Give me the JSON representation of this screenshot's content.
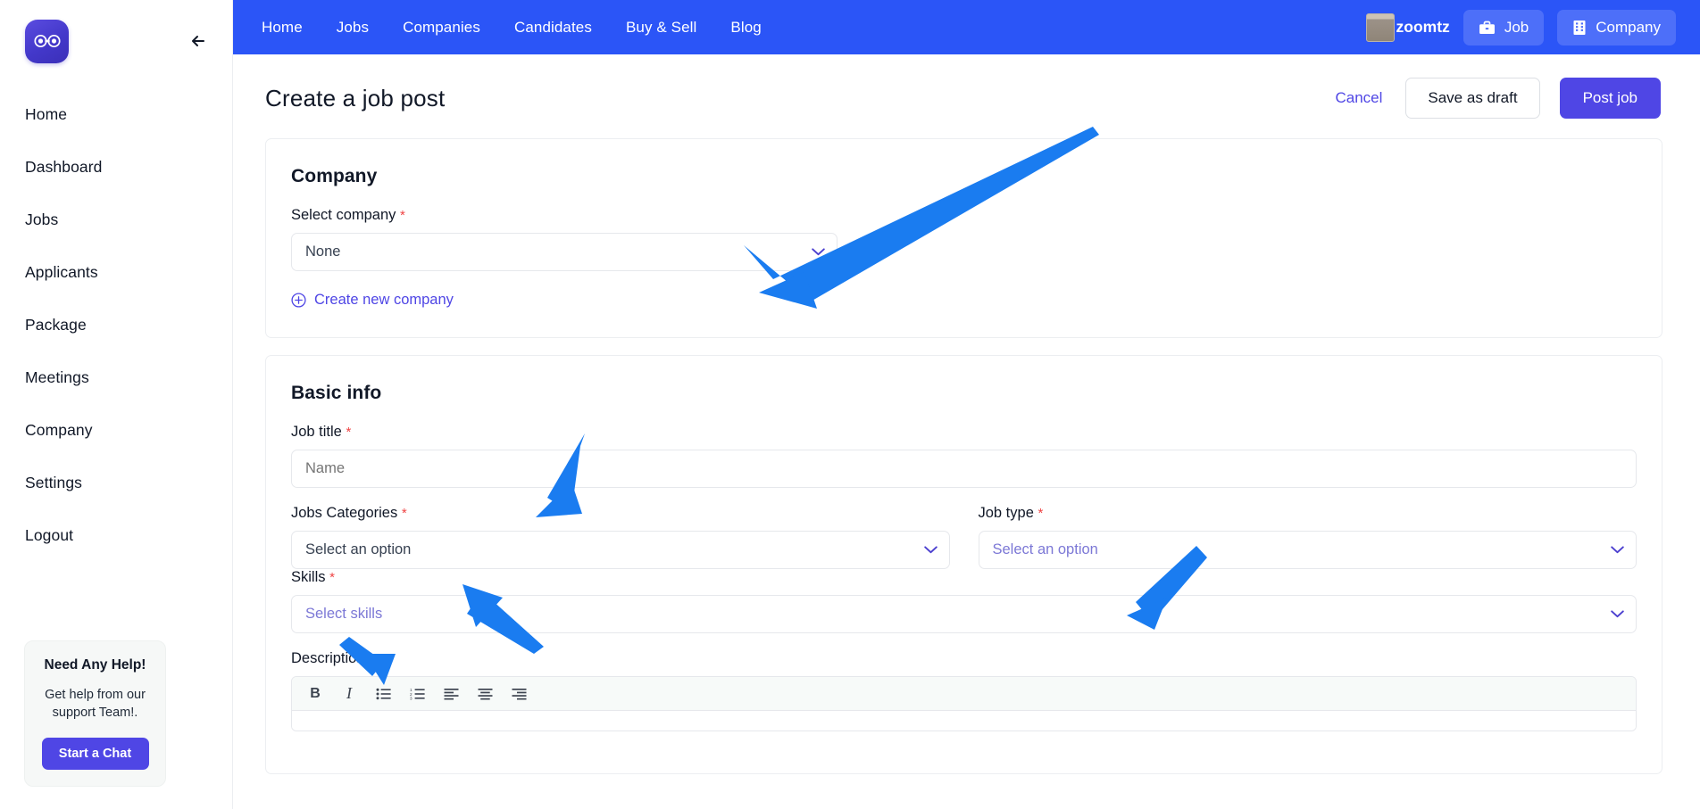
{
  "brand": {
    "logo_icon": "binoculars-icon",
    "accent": "#4f46e5",
    "topbar_bg": "#2b55f7",
    "required_mark": "*"
  },
  "sidebar": {
    "collapse_icon": "arrow-left-icon",
    "items": [
      {
        "label": "Home"
      },
      {
        "label": "Dashboard"
      },
      {
        "label": "Jobs"
      },
      {
        "label": "Applicants"
      },
      {
        "label": "Package"
      },
      {
        "label": "Meetings"
      },
      {
        "label": "Company"
      },
      {
        "label": "Settings"
      },
      {
        "label": "Logout"
      }
    ],
    "help_card": {
      "title": "Need Any Help!",
      "text": "Get help from our support Team!.",
      "button": "Start a Chat"
    }
  },
  "topbar": {
    "nav": [
      {
        "label": "Home"
      },
      {
        "label": "Jobs"
      },
      {
        "label": "Companies"
      },
      {
        "label": "Candidates"
      },
      {
        "label": "Buy & Sell"
      },
      {
        "label": "Blog"
      }
    ],
    "user": {
      "name": "zoomtz",
      "avatar_icon": "user-avatar"
    },
    "actions": [
      {
        "label": "Job",
        "icon": "briefcase-icon"
      },
      {
        "label": "Company",
        "icon": "building-icon"
      }
    ]
  },
  "page": {
    "title": "Create a job post",
    "cancel_label": "Cancel",
    "save_draft_label": "Save as draft",
    "post_job_label": "Post job"
  },
  "company_section": {
    "title": "Company",
    "select_company_label": "Select company",
    "select_company_value": "None",
    "create_new_label": "Create new company",
    "create_new_icon": "plus-circle-icon",
    "chevron_icon": "chevron-down-icon"
  },
  "basic_info": {
    "title": "Basic info",
    "job_title_label": "Job title",
    "job_title_placeholder": "Name",
    "job_categories_label": "Jobs Categories",
    "job_categories_value": "Select an option",
    "job_type_label": "Job type",
    "job_type_value": "Select an option",
    "skills_label": "Skills",
    "skills_value": "Select skills",
    "description_label": "Description",
    "editor_tools": [
      {
        "name": "bold",
        "glyph": "B"
      },
      {
        "name": "italic",
        "glyph": "I"
      },
      {
        "name": "bullet-list",
        "glyph": ""
      },
      {
        "name": "numbered-list",
        "glyph": ""
      },
      {
        "name": "align-left",
        "glyph": ""
      },
      {
        "name": "align-center",
        "glyph": ""
      },
      {
        "name": "align-right",
        "glyph": ""
      }
    ]
  }
}
